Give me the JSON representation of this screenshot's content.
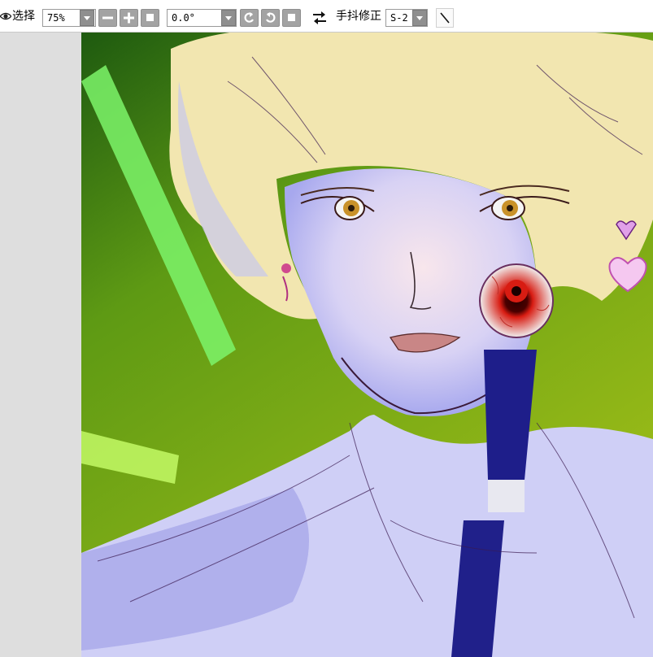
{
  "toolbar": {
    "select_label": "选择",
    "zoom_value": "75%",
    "rotation_value": "0.0°",
    "stabilizer_label": "手抖修正",
    "stabilizer_value": "S-2"
  },
  "icons": [
    "eye-icon",
    "chevron-down-icon",
    "minus-icon",
    "plus-icon",
    "stop-icon",
    "rotate-left-icon",
    "rotate-right-icon",
    "reset-icon",
    "flip-icon",
    "line-icon"
  ],
  "colors": {
    "toolbar_bg": "#ffffff",
    "workspace_bg": "#dedede",
    "button_gray": "#a3a3a3",
    "background_green": "#8fb015",
    "hair_blonde": "#f2e6b0",
    "skin_lavender": "#b7b8f3",
    "eyeball_red": "#d81c12"
  }
}
